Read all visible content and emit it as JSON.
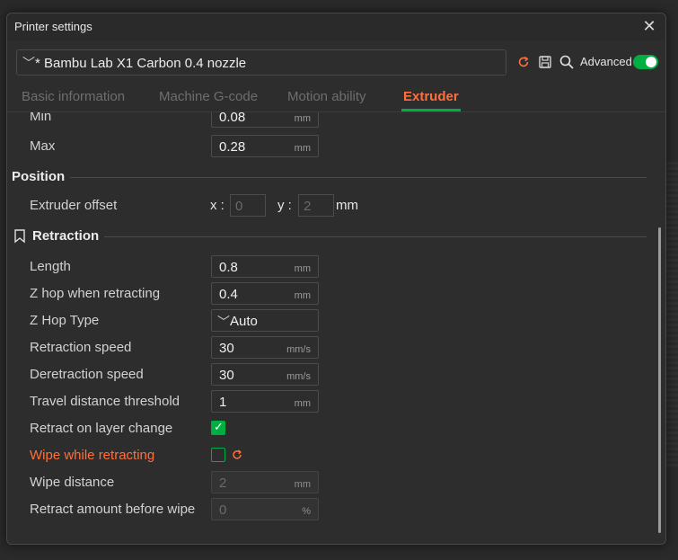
{
  "window": {
    "title": "Printer settings",
    "close_glyph": "✕"
  },
  "preset": {
    "name": "* Bambu Lab X1 Carbon 0.4 nozzle",
    "chevron": "﹀"
  },
  "toolbar": {
    "advanced_label": "Advanced",
    "advanced_on": true
  },
  "tabs": [
    {
      "label": "Basic information",
      "active": false
    },
    {
      "label": "Machine G-code",
      "active": false
    },
    {
      "label": "Motion ability",
      "active": false
    },
    {
      "label": "Extruder",
      "active": true
    }
  ],
  "layer_height": {
    "min_label": "Min",
    "min_value": "0.08",
    "min_unit": "mm",
    "max_label": "Max",
    "max_value": "0.28",
    "max_unit": "mm"
  },
  "position": {
    "title": "Position",
    "offset_label": "Extruder offset",
    "x_label": "x :",
    "x_value": "0",
    "y_label": "y :",
    "y_value": "2",
    "unit": "mm"
  },
  "retraction": {
    "title": "Retraction",
    "rows": {
      "length": {
        "label": "Length",
        "value": "0.8",
        "unit": "mm"
      },
      "z_hop": {
        "label": "Z hop when retracting",
        "value": "0.4",
        "unit": "mm"
      },
      "z_hop_type": {
        "label": "Z Hop Type",
        "value": "Auto",
        "chevron": "﹀"
      },
      "retraction_speed": {
        "label": "Retraction speed",
        "value": "30",
        "unit": "mm/s"
      },
      "deretraction_speed": {
        "label": "Deretraction speed",
        "value": "30",
        "unit": "mm/s"
      },
      "travel_threshold": {
        "label": "Travel distance threshold",
        "value": "1",
        "unit": "mm"
      },
      "retract_layer_change": {
        "label": "Retract on layer change",
        "checked": true,
        "checkmark": "✓"
      },
      "wipe": {
        "label": "Wipe while retracting",
        "checked": false
      },
      "wipe_distance": {
        "label": "Wipe distance",
        "value": "2",
        "unit": "mm"
      },
      "retract_before_wipe": {
        "label": "Retract amount before wipe",
        "value": "0",
        "unit": "%"
      }
    }
  },
  "colors": {
    "accent_orange": "#ff6f3c",
    "accent_green": "#00ae42"
  },
  "icons": {
    "undo": "undo-icon",
    "save": "save-icon",
    "search": "search-icon",
    "bookmark": "bookmark-icon",
    "close": "close-icon"
  }
}
